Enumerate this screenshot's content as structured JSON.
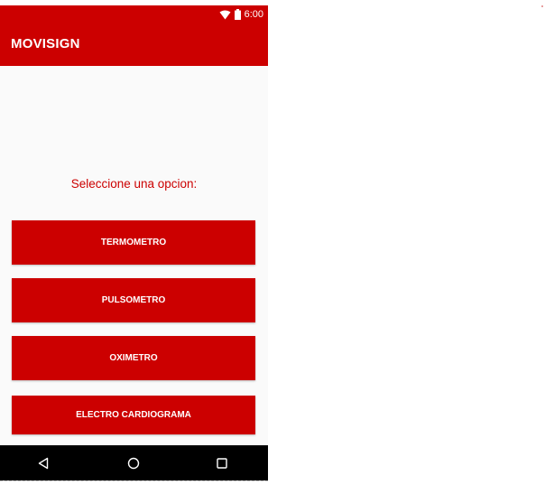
{
  "status_bar": {
    "time": "6:00",
    "wifi_icon": "wifi-icon",
    "battery_icon": "battery-icon"
  },
  "app_bar": {
    "title": "MOVISIGN"
  },
  "main": {
    "prompt": "Seleccione una opcion:",
    "buttons": [
      {
        "label": "TERMOMETRO"
      },
      {
        "label": "PULSOMETRO"
      },
      {
        "label": "OXIMETRO"
      },
      {
        "label": "ELECTRO CARDIOGRAMA"
      }
    ]
  },
  "nav_bar": {
    "back_icon": "back-triangle-icon",
    "home_icon": "home-circle-icon",
    "recents_icon": "recents-square-icon"
  },
  "colors": {
    "primary": "#cc0000",
    "background": "#fafafa",
    "nav": "#000000"
  }
}
